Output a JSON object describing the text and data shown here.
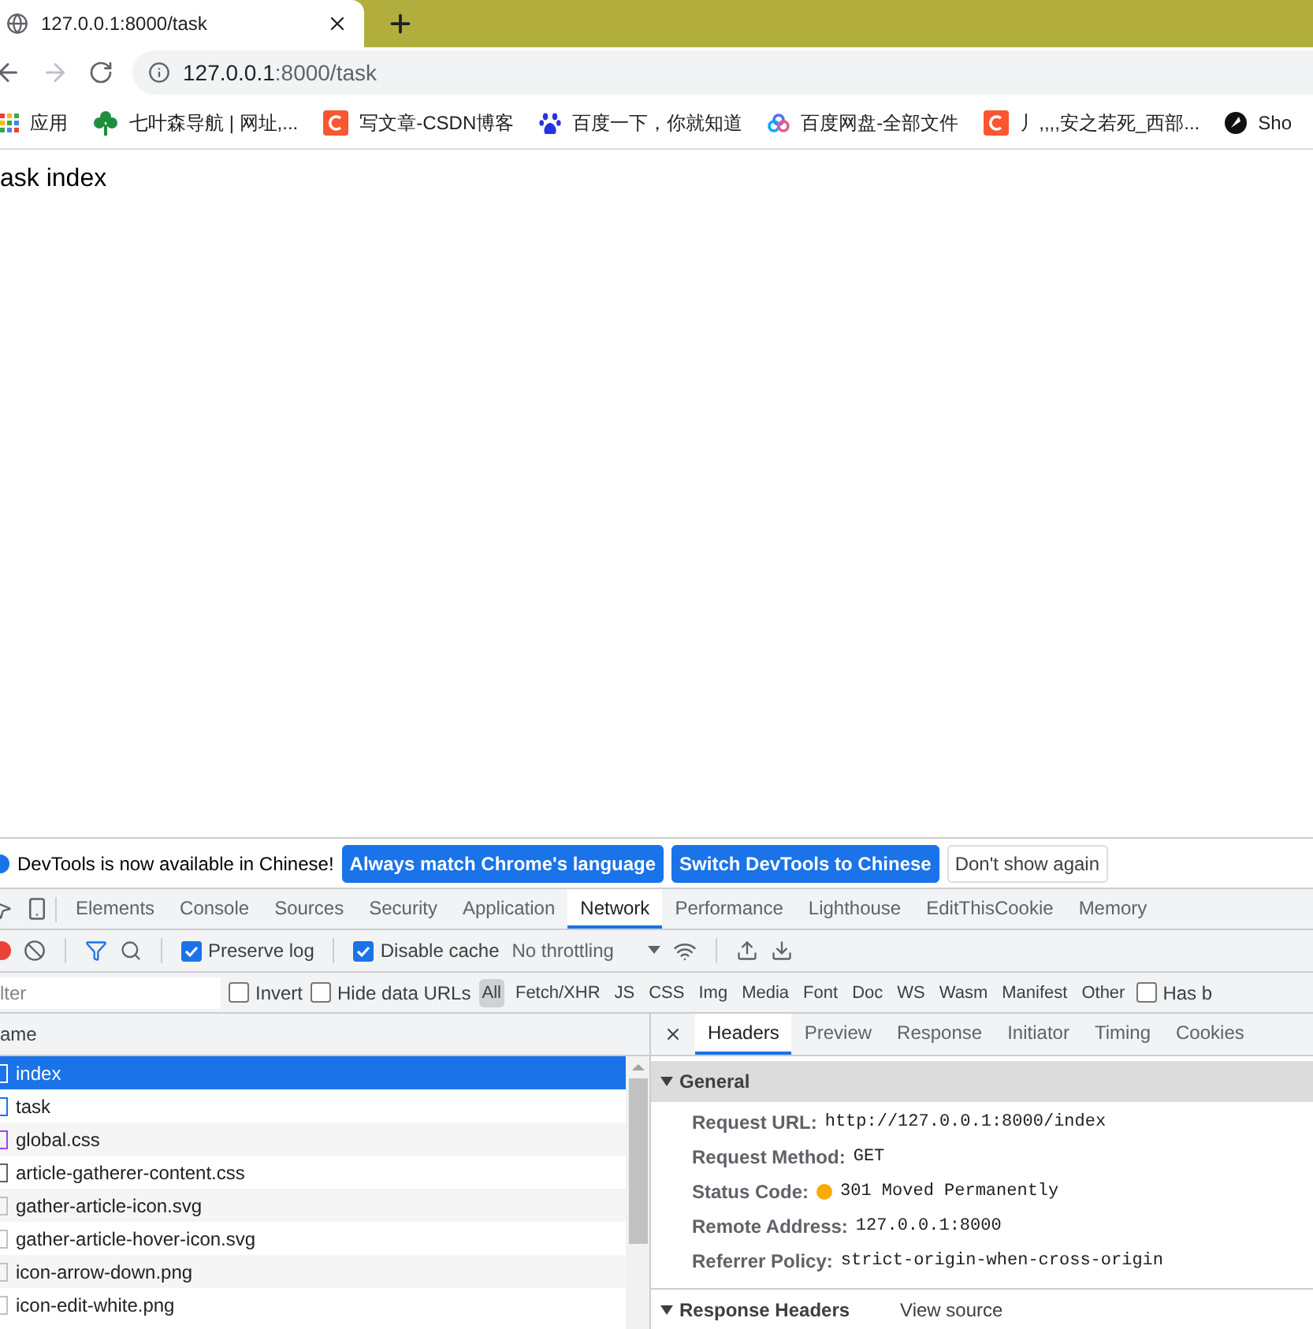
{
  "browser_tab": {
    "title": "127.0.0.1:8000/task"
  },
  "address_bar": {
    "host": "127.0.0.1",
    "path": ":8000/task"
  },
  "bookmarks": [
    {
      "label": "应用",
      "kind": "apps"
    },
    {
      "label": "七叶森导航 | 网址,...",
      "kind": "clover"
    },
    {
      "label": "写文章-CSDN博客",
      "kind": "csdn"
    },
    {
      "label": "百度一下，你就知道",
      "kind": "paw"
    },
    {
      "label": "百度网盘-全部文件",
      "kind": "cloud"
    },
    {
      "label": "丿,,,,安之若死_西部...",
      "kind": "csdn"
    },
    {
      "label": "Sho",
      "kind": "dark"
    }
  ],
  "page": {
    "text": "ask index"
  },
  "infobar": {
    "message": "DevTools is now available in Chinese!",
    "buttons": [
      {
        "label": "Always match Chrome's language",
        "kind": "primary"
      },
      {
        "label": "Switch DevTools to Chinese",
        "kind": "primary"
      },
      {
        "label": "Don't show again",
        "kind": "secondary"
      }
    ]
  },
  "devtools_tabs": [
    {
      "label": "Elements",
      "selected": false
    },
    {
      "label": "Console",
      "selected": false
    },
    {
      "label": "Sources",
      "selected": false
    },
    {
      "label": "Security",
      "selected": false
    },
    {
      "label": "Application",
      "selected": false
    },
    {
      "label": "Network",
      "selected": true
    },
    {
      "label": "Performance",
      "selected": false
    },
    {
      "label": "Lighthouse",
      "selected": false
    },
    {
      "label": "EditThisCookie",
      "selected": false
    },
    {
      "label": "Memory",
      "selected": false
    }
  ],
  "network_toolbar": {
    "recording": true,
    "preserve_log": {
      "label": "Preserve log",
      "checked": true
    },
    "disable_cache": {
      "label": "Disable cache",
      "checked": true
    },
    "throttling": "No throttling"
  },
  "filter_bar": {
    "placeholder": "lter",
    "invert": {
      "label": "Invert",
      "checked": false
    },
    "hide_data_urls": {
      "label": "Hide data URLs",
      "checked": false
    },
    "types": [
      {
        "label": "All",
        "selected": true
      },
      {
        "label": "Fetch/XHR",
        "selected": false
      },
      {
        "label": "JS",
        "selected": false
      },
      {
        "label": "CSS",
        "selected": false
      },
      {
        "label": "Img",
        "selected": false
      },
      {
        "label": "Media",
        "selected": false
      },
      {
        "label": "Font",
        "selected": false
      },
      {
        "label": "Doc",
        "selected": false
      },
      {
        "label": "WS",
        "selected": false
      },
      {
        "label": "Wasm",
        "selected": false
      },
      {
        "label": "Manifest",
        "selected": false
      },
      {
        "label": "Other",
        "selected": false
      }
    ],
    "has_blocked": {
      "label": "Has b",
      "checked": false
    }
  },
  "requests": {
    "column": "ame",
    "rows": [
      {
        "name": "index",
        "selected": true,
        "color": "#ffffff"
      },
      {
        "name": "task",
        "selected": false,
        "color": "#1a73e8"
      },
      {
        "name": "global.css",
        "selected": false,
        "color": "#a142f4"
      },
      {
        "name": "article-gatherer-content.css",
        "selected": false,
        "color": "#5f6368"
      },
      {
        "name": "gather-article-icon.svg",
        "selected": false,
        "color": "#bdc1c6"
      },
      {
        "name": "gather-article-hover-icon.svg",
        "selected": false,
        "color": "#bdc1c6"
      },
      {
        "name": "icon-arrow-down.png",
        "selected": false,
        "color": "#bdc1c6"
      },
      {
        "name": "icon-edit-white.png",
        "selected": false,
        "color": "#bdc1c6"
      }
    ]
  },
  "details": {
    "tabs": [
      {
        "label": "Headers",
        "selected": true
      },
      {
        "label": "Preview",
        "selected": false
      },
      {
        "label": "Response",
        "selected": false
      },
      {
        "label": "Initiator",
        "selected": false
      },
      {
        "label": "Timing",
        "selected": false
      },
      {
        "label": "Cookies",
        "selected": false
      }
    ],
    "general": {
      "title": "General",
      "expanded": true,
      "fields": [
        {
          "label": "Request URL:",
          "value": "http://127.0.0.1:8000/index"
        },
        {
          "label": "Request Method:",
          "value": "GET"
        },
        {
          "label": "Status Code:",
          "value": "301 Moved Permanently",
          "color": "#f9ab00"
        },
        {
          "label": "Remote Address:",
          "value": "127.0.0.1:8000"
        },
        {
          "label": "Referrer Policy:",
          "value": "strict-origin-when-cross-origin"
        }
      ]
    },
    "response_headers": {
      "title": "Response Headers",
      "expanded": true,
      "view_source": "View source"
    }
  }
}
